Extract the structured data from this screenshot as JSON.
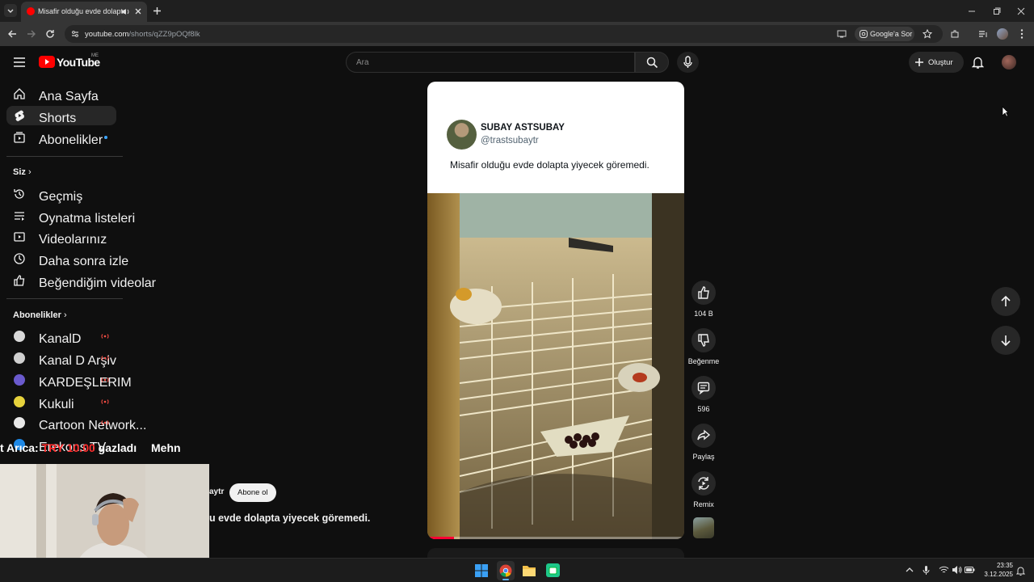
{
  "browser": {
    "tab_title": "Misafir olduğu evde dolaptı",
    "url_host": "youtube.com",
    "url_path": "/shorts/qZZ9pOQf8lk",
    "google_lens": "Google'a Sor"
  },
  "header": {
    "logo_text": "YouTube",
    "region": "ME",
    "search_placeholder": "Ara",
    "create_label": "Oluştur"
  },
  "sidebar": {
    "main": [
      {
        "label": "Ana Sayfa",
        "icon": "home-icon"
      },
      {
        "label": "Shorts",
        "icon": "shorts-icon"
      },
      {
        "label": "Abonelikler",
        "icon": "subscriptions-icon"
      }
    ],
    "you_title": "Siz",
    "you": [
      {
        "label": "Geçmiş",
        "icon": "history-icon"
      },
      {
        "label": "Oynatma listeleri",
        "icon": "playlists-icon"
      },
      {
        "label": "Videolarınız",
        "icon": "your-videos-icon"
      },
      {
        "label": "Daha sonra izle",
        "icon": "watch-later-icon"
      },
      {
        "label": "Beğendiğim videolar",
        "icon": "liked-videos-icon"
      }
    ],
    "subs_title": "Abonelikler",
    "subs": [
      {
        "label": "KanalD",
        "color": "#cfcfcf"
      },
      {
        "label": "Kanal D Arşiv",
        "color": "#d9d9d9"
      },
      {
        "label": "KARDEŞLERIM",
        "color": "#6a5acd"
      },
      {
        "label": "Kukuli",
        "color": "#e6d23c"
      },
      {
        "label": "Cartoon Network...",
        "color": "#e8e8e8"
      },
      {
        "label": "Erekons TV",
        "color": "#1e88e5"
      }
    ]
  },
  "video": {
    "author_name": "SUBAY ASTSUBAY",
    "author_handle": "@trastsubaytr",
    "caption": "Misafir olduğu evde dolapta yiyecek göremedi.",
    "progress": 0.1
  },
  "actions": {
    "likes": "104 B",
    "dislike": "Beğenme",
    "comments": "596",
    "share": "Paylaş",
    "remix": "Remix"
  },
  "below_video": {
    "channel_partial": "aytr",
    "subscribe": "Abone ol",
    "title_partial": "u evde dolapta yiyecek göremedi."
  },
  "overlay": {
    "ticker_left": "t Arıca:",
    "ticker_amount": "TRY 10.00",
    "ticker_mid": "gazladı",
    "ticker_right": "Mehn"
  },
  "taskbar": {
    "time": "23:35",
    "date": "3.12.2025"
  }
}
